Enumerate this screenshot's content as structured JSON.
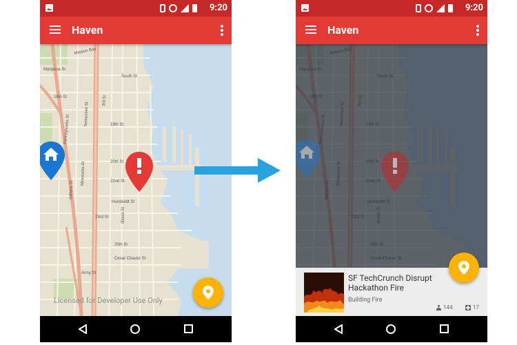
{
  "colors": {
    "appbar": "#e53935",
    "statusbar": "#c62828",
    "fab": "#ffb300",
    "arrow": "#29a3e0",
    "home_pin": "#1976d2",
    "alert_pin": "#e53935",
    "water": "#c6dcef"
  },
  "status": {
    "time": "9:20"
  },
  "app": {
    "title": "Haven",
    "menu_icon": "hamburger-menu-icon",
    "overflow_icon": "more-vert-icon"
  },
  "map": {
    "license_text": "Licensed for Developer Use Only",
    "streets": {
      "mission_bay": "Mission Bay",
      "illinois": "Illinois St",
      "16th": "16th St",
      "18th": "18th St",
      "20th": "20th St",
      "22nd": "22nd St",
      "23rd": "23rd St",
      "25th": "25th St",
      "humboldt": "Humboldt St",
      "cesar_chavez": "Cesar Chavez St",
      "army": "Army St",
      "3rd": "3rd St",
      "minnesota": "Minnesota St",
      "indiana": "Indiana St",
      "tennessee": "Tennessee St",
      "pennsylvania": "Pennsylvania St",
      "mariposa": "Mariposa St",
      "south": "South St"
    }
  },
  "incident": {
    "title": "SF TechCrunch Disrupt Hackathon Fire",
    "category": "Building Fire",
    "people_count": "144",
    "support_count": "17"
  },
  "icons": {
    "home_pin": "home-pin-icon",
    "alert_pin": "alert-pin-icon",
    "fab": "location-pin-icon"
  }
}
